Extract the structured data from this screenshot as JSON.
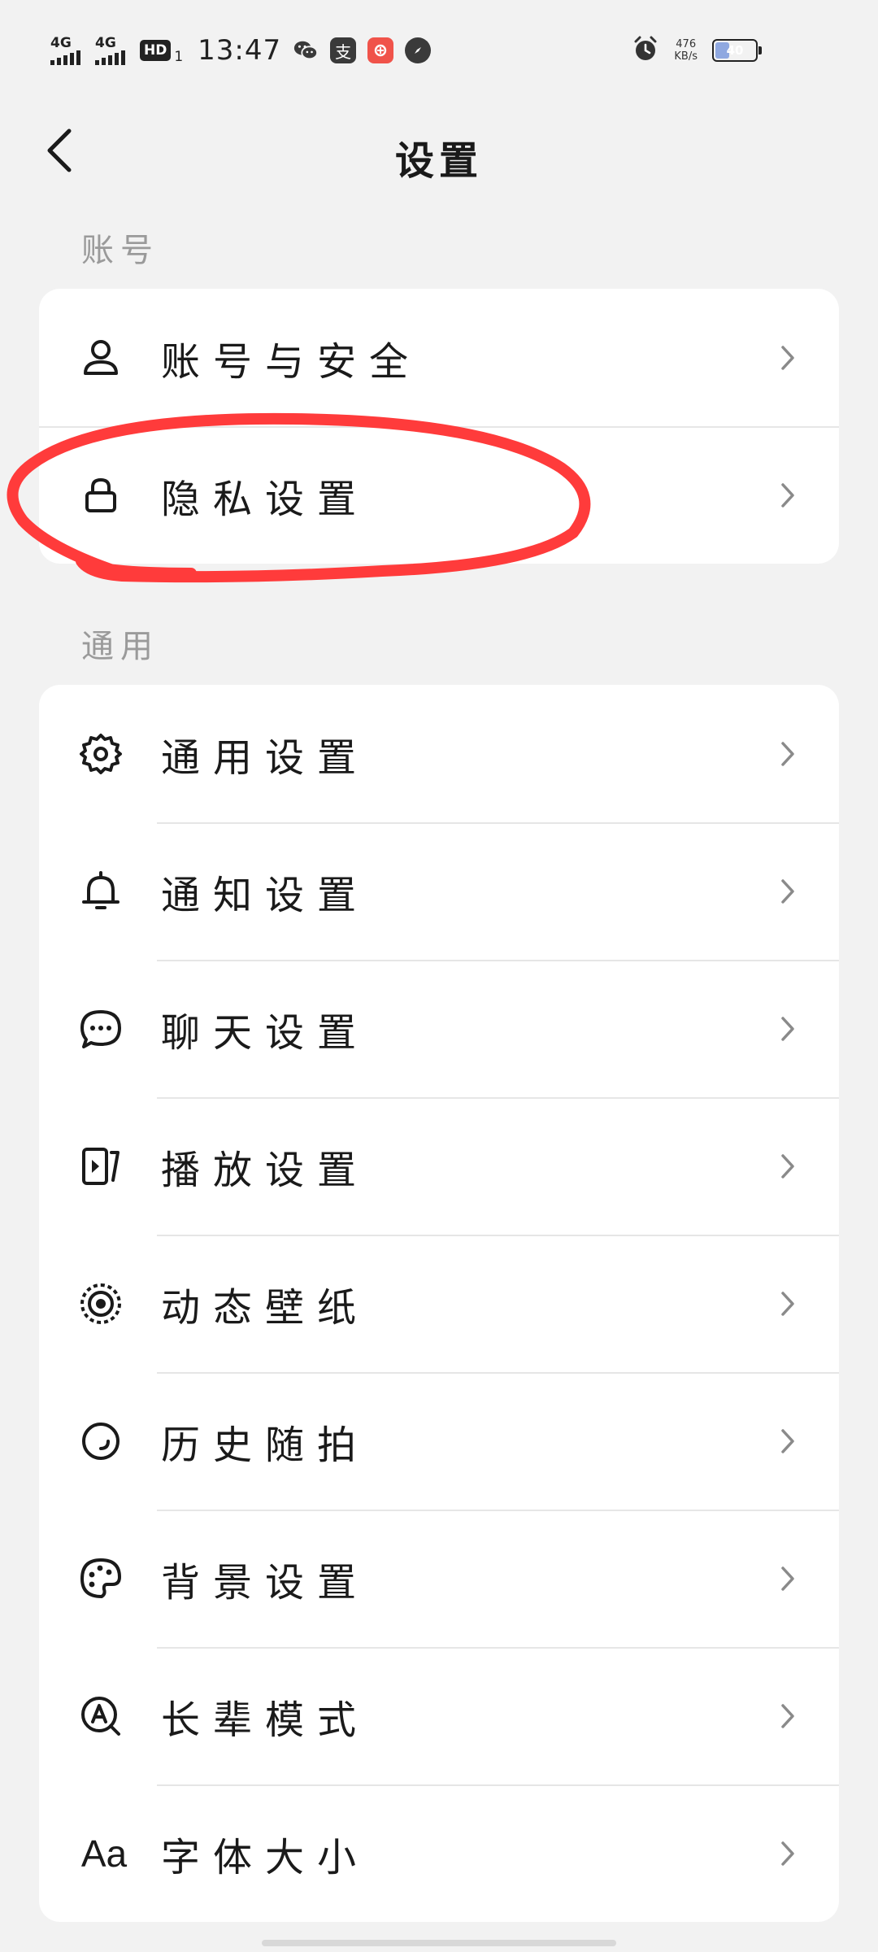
{
  "status_bar": {
    "signal1_type": "4G",
    "signal2_type": "4G",
    "hd_label": "HD",
    "hd_sub": "1",
    "time": "13:47",
    "alipay_label": "支",
    "net_speed_value": "476",
    "net_speed_unit": "KB/s",
    "battery_level": "40",
    "colors": {
      "wechat": "#3a3a3a",
      "alipay": "#3a3a3a",
      "pinduoduo": "#f0534a",
      "compass": "#3a3a3a",
      "battery_fill": "#8fa8e0"
    }
  },
  "header": {
    "title": "设置"
  },
  "sections": {
    "account": {
      "label": "账号",
      "items": [
        {
          "label": "账号与安全",
          "icon": "user-icon"
        },
        {
          "label": "隐私设置",
          "icon": "lock-icon"
        }
      ]
    },
    "general": {
      "label": "通用",
      "items": [
        {
          "label": "通用设置",
          "icon": "gear-icon"
        },
        {
          "label": "通知设置",
          "icon": "bell-icon"
        },
        {
          "label": "聊天设置",
          "icon": "chat-bubble-icon"
        },
        {
          "label": "播放设置",
          "icon": "play-icon"
        },
        {
          "label": "动态壁纸",
          "icon": "wallpaper-icon"
        },
        {
          "label": "历史随拍",
          "icon": "history-icon"
        },
        {
          "label": "背景设置",
          "icon": "palette-icon"
        },
        {
          "label": "长辈模式",
          "icon": "elder-mode-icon"
        },
        {
          "label": "字体大小",
          "icon": "font-size-icon",
          "glyph": "Aa"
        }
      ]
    }
  },
  "annotation": {
    "color": "#ff3b3b",
    "target": "隐私设置"
  }
}
